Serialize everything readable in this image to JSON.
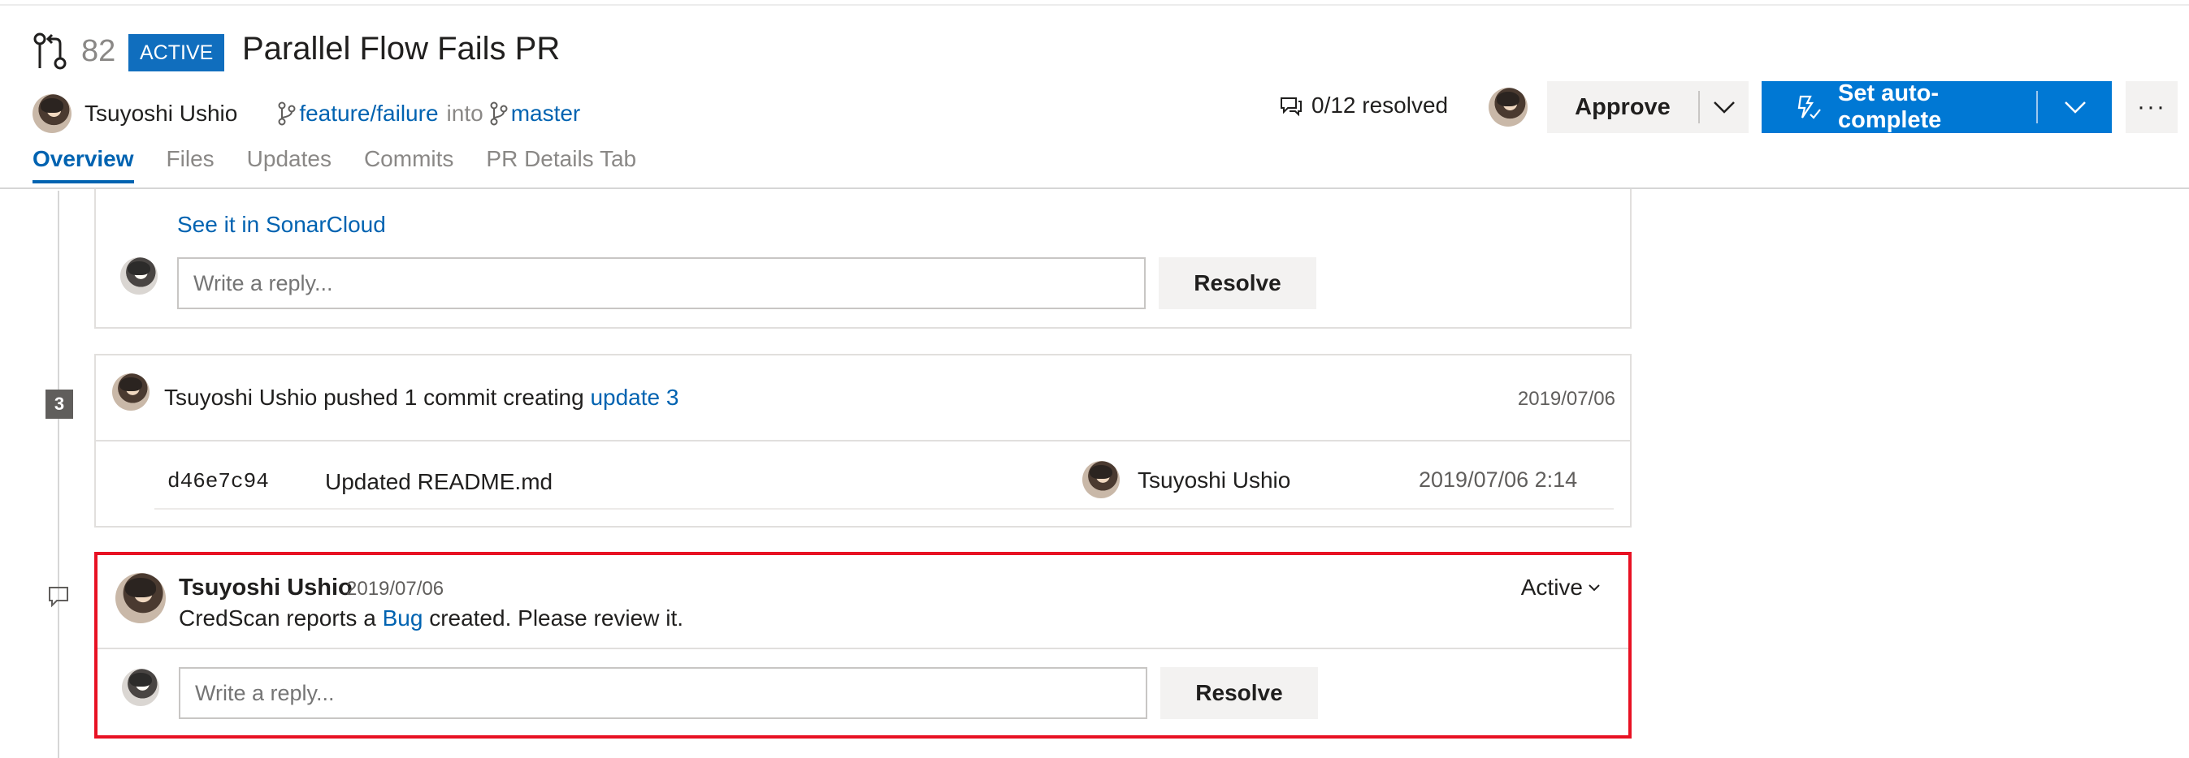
{
  "pr": {
    "id": "82",
    "status": "ACTIVE",
    "title": "Parallel Flow Fails PR",
    "author": "Tsuyoshi Ushio",
    "source_branch": "feature/failure",
    "into": "into",
    "target_branch": "master"
  },
  "tabs": [
    "Overview",
    "Files",
    "Updates",
    "Commits",
    "PR Details Tab"
  ],
  "toolbar": {
    "resolved": "0/12 resolved",
    "approve_label": "Approve",
    "autocomplete_label": "Set auto-complete",
    "more_label": "···"
  },
  "thread1": {
    "link": "See it in SonarCloud",
    "reply_placeholder": "Write a reply...",
    "resolve_label": "Resolve"
  },
  "update": {
    "badge": "3",
    "text_prefix": "Tsuyoshi Ushio pushed 1 commit creating",
    "link": "update 3",
    "date": "2019/07/06",
    "commit": {
      "hash": "d46e7c94",
      "message": "Updated README.md",
      "author": "Tsuyoshi Ushio",
      "date": "2019/07/06 2:14"
    }
  },
  "thread2": {
    "author": "Tsuyoshi Ushio",
    "date": "2019/07/06",
    "status": "Active",
    "body_prefix": "CredScan reports a",
    "body_link": "Bug",
    "body_suffix": "created. Please review it.",
    "reply_placeholder": "Write a reply...",
    "resolve_label": "Resolve"
  },
  "colors": {
    "accent": "#0078d4",
    "link": "#0063b1",
    "highlight_border": "#e81123"
  },
  "icons": {
    "pr": "pull-request-icon",
    "branch": "branch-icon",
    "comments": "comment-icon",
    "autocomplete": "auto-complete-icon",
    "chevron": "chevron-down-icon"
  }
}
